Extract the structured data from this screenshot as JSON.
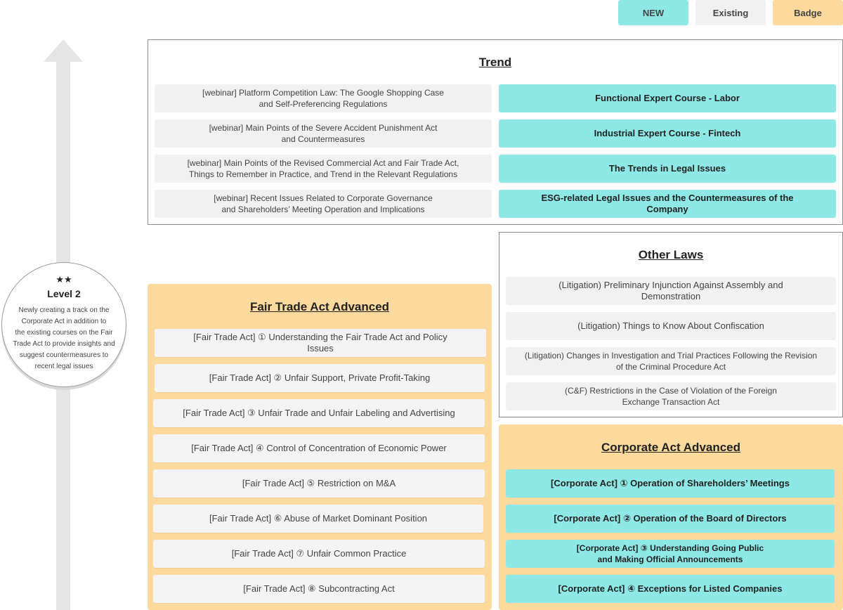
{
  "legend": {
    "new": "NEW",
    "existing": "Existing",
    "badge": "Badge"
  },
  "level": {
    "stars": "★★",
    "title": "Level 2",
    "description": "Newly creating a track on the\nCorporate Act in addition to\nthe existing courses on the Fair\nTrade Act to provide insights and\nsuggest countermeasures to\nrecent legal issues"
  },
  "trend": {
    "title": "Trend",
    "left_items": [
      "[webinar] Platform Competition Law: The Google Shopping Case\nand Self-Preferencing Regulations",
      "[webinar] Main Points of the Severe Accident Punishment Act\nand Countermeasures",
      "[webinar] Main Points of the Revised Commercial Act and Fair Trade Act,\nThings to Remember in Practice, and Trend in the Relevant Regulations",
      "[webinar] Recent Issues Related to Corporate Governance\nand Shareholders’ Meeting Operation and Implications"
    ],
    "right_items": [
      "Functional Expert Course - Labor",
      "Industrial Expert Course - Fintech",
      "The Trends in Legal Issues",
      "ESG-related Legal Issues and the Countermeasures of the Company"
    ]
  },
  "other_laws": {
    "title": "Other Laws",
    "items": [
      "(Litigation) Preliminary Injunction Against Assembly and Demonstration",
      "(Litigation) Things to Know About Confiscation",
      "(Litigation) Changes in Investigation and Trial Practices Following the Revision\nof the Criminal Procedure Act",
      "(C&F) Restrictions in the Case of Violation of the Foreign\nExchange Transaction Act"
    ]
  },
  "fair_trade": {
    "title": "Fair Trade Act Advanced",
    "items": [
      "[Fair Trade Act] ① Understanding the Fair Trade Act and Policy Issues",
      "[Fair Trade Act] ② Unfair Support, Private Profit-Taking",
      "[Fair Trade Act] ③ Unfair Trade and Unfair Labeling and Advertising",
      "[Fair Trade Act] ④ Control of Concentration of Economic Power",
      "[Fair Trade Act] ⑤ Restriction on M&A",
      "[Fair Trade Act] ⑥ Abuse of Market Dominant Position",
      "[Fair Trade Act] ⑦ Unfair Common Practice",
      "[Fair Trade Act] ⑧ Subcontracting Act"
    ]
  },
  "corporate": {
    "title": "Corporate Act Advanced",
    "items": [
      "[Corporate Act] ① Operation of Shareholders’ Meetings",
      "[Corporate Act] ② Operation of the Board of Directors",
      "[Corporate Act] ③ Understanding Going Public\nand Making Official Announcements",
      "[Corporate Act] ④ Exceptions for Listed Companies"
    ]
  },
  "colors": {
    "new": "#8ee9e6",
    "existing": "#f1f1f1",
    "badge": "#fcd99c"
  }
}
